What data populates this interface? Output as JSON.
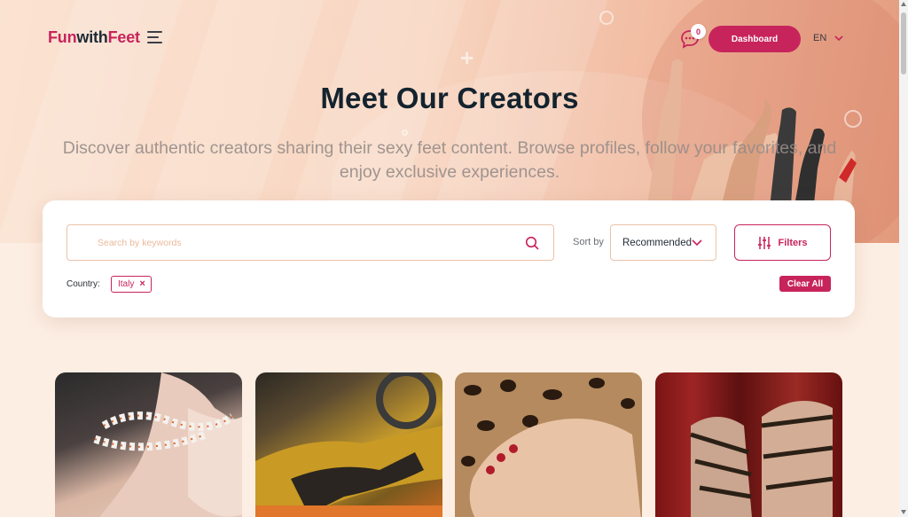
{
  "header": {
    "logo": {
      "part1": "Fun",
      "part2": "with",
      "part3": "Feet"
    },
    "notifications_count": "0",
    "dashboard_label": "Dashboard",
    "language": "EN"
  },
  "hero": {
    "title": "Meet Our Creators",
    "subtitle": "Discover authentic creators sharing their sexy feet content. Browse profiles, follow your favorites, and enjoy exclusive experiences."
  },
  "search": {
    "placeholder": "Search by keywords",
    "sort_label": "Sort by",
    "sort_value": "Recommended",
    "filters_label": "Filters",
    "country_label": "Country:",
    "country_chip": "Italy",
    "clear_label": "Clear All"
  },
  "creators": [
    {
      "image": "creator-photo-rope-feet"
    },
    {
      "image": "creator-photo-car-stockings"
    },
    {
      "image": "creator-photo-leopard-feet"
    },
    {
      "image": "creator-photo-sandals-red-curtain"
    }
  ],
  "colors": {
    "brand": "#c8245c",
    "text_dark": "#14232e",
    "border_accent": "#ecc2a8",
    "page_bg": "#fdeee3"
  }
}
